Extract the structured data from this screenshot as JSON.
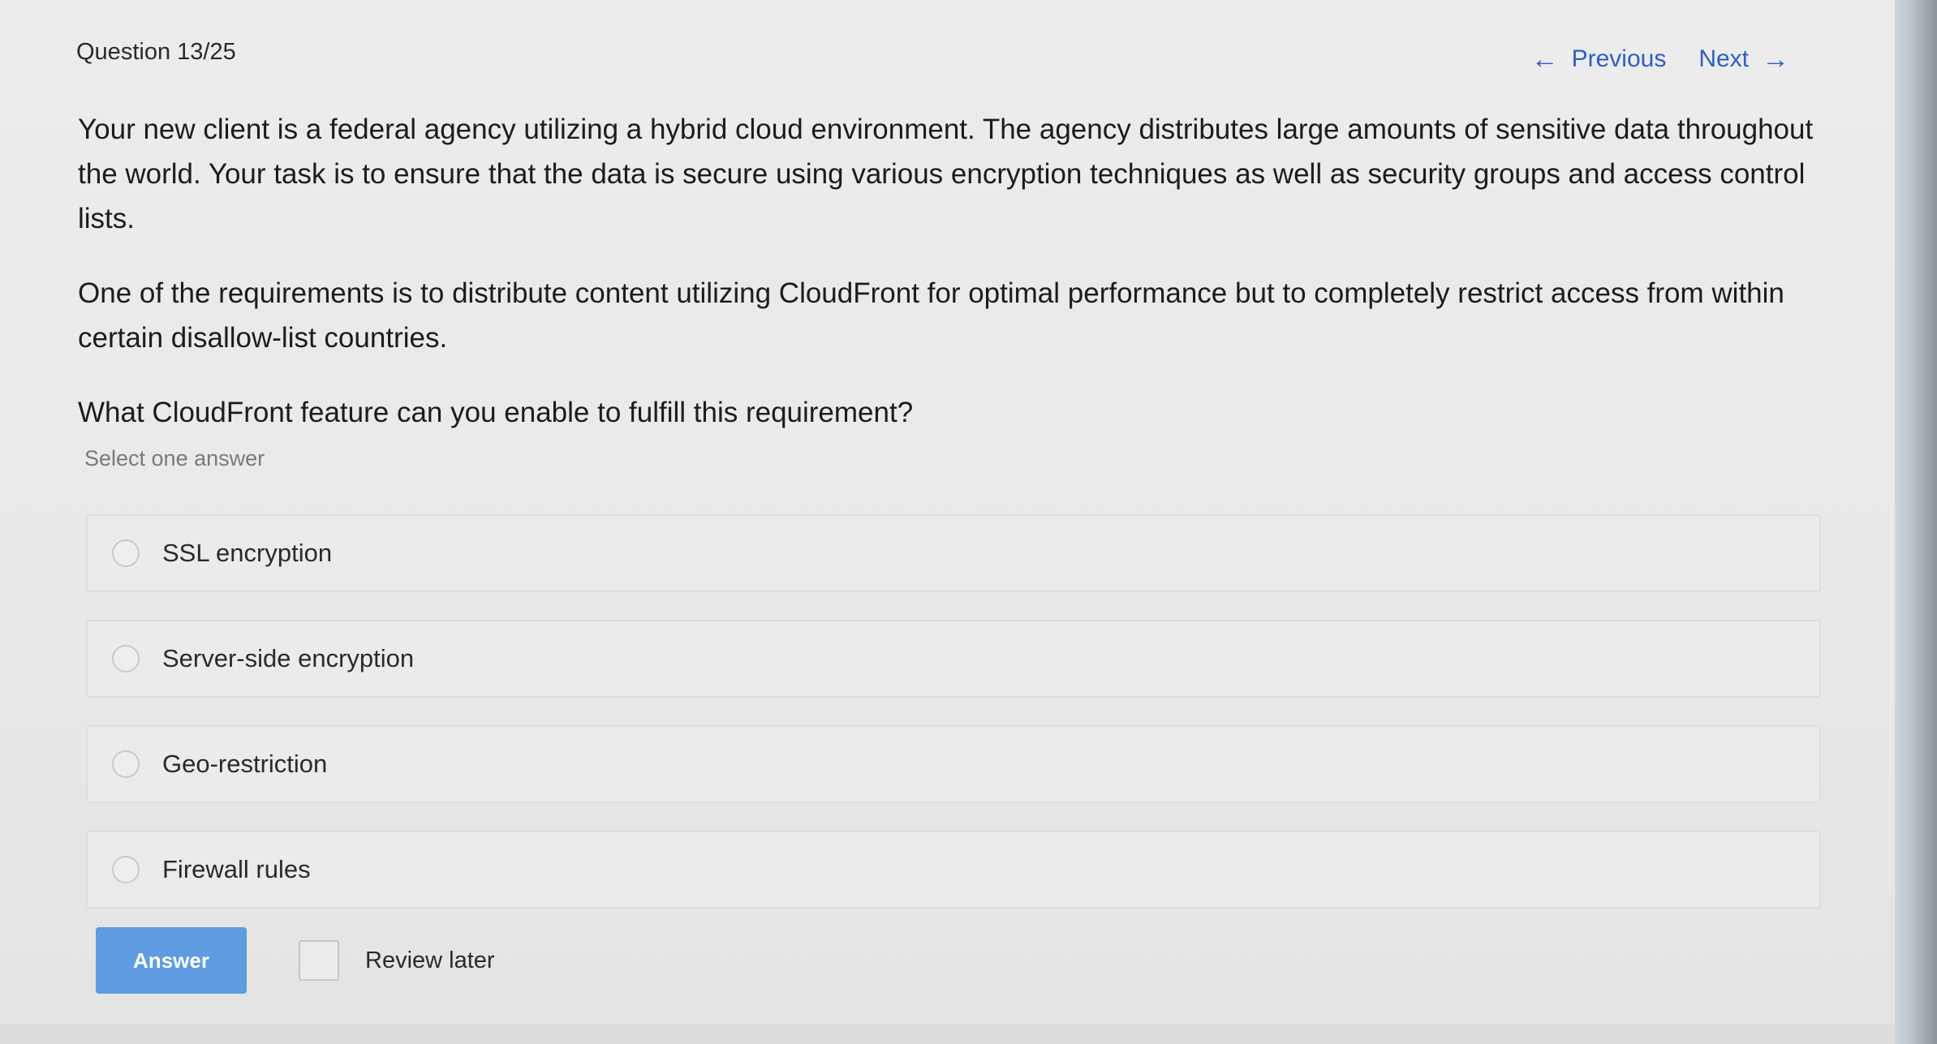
{
  "header": {
    "question_counter": "Question 13/25",
    "previous_label": "Previous",
    "next_label": "Next",
    "previous_icon": "arrow-left-icon",
    "next_icon": "arrow-right-icon"
  },
  "question": {
    "paragraph_1": "Your new client is a federal agency utilizing a hybrid cloud environment. The agency distributes large amounts of sensitive data throughout the world. Your task is to ensure that the data is secure using various encryption techniques as well as security groups and access control lists.",
    "paragraph_2": "One of the requirements is to distribute content utilizing CloudFront for optimal performance but to completely restrict access from within certain disallow-list countries.",
    "prompt": "What CloudFront feature can you enable to fulfill this requirement?",
    "hint": "Select one answer"
  },
  "options": [
    {
      "label": "SSL encryption"
    },
    {
      "label": "Server-side encryption"
    },
    {
      "label": "Geo-restriction"
    },
    {
      "label": "Firewall rules"
    }
  ],
  "footer": {
    "answer_label": "Answer",
    "review_label": "Review later"
  },
  "colors": {
    "link": "#2f5fc0",
    "answer_button": "#5f9be0",
    "page_background": "#e9e9e9"
  }
}
